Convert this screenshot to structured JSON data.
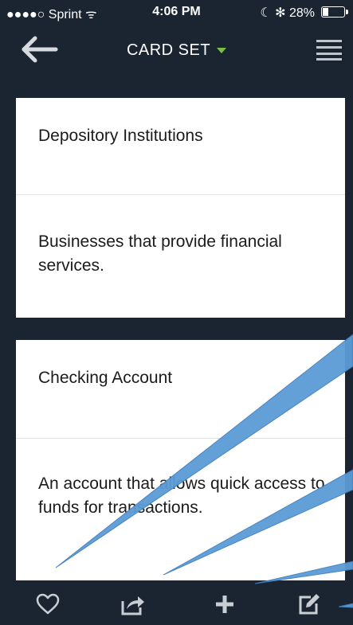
{
  "status_bar": {
    "carrier": "●●●●○ Sprint ᯤ",
    "time": "4:06 PM",
    "battery": "☾ ✻ 28%",
    "battery_level": 0.28
  },
  "navbar": {
    "title": "CARD SET",
    "back_icon": "arrow-left-icon",
    "menu_icon": "hamburger-menu-icon",
    "caret_color": "#7bc043"
  },
  "cards": [
    {
      "term": "Depository Institutions",
      "definition": "Businesses that provide financial services."
    },
    {
      "term": "Checking Account",
      "definition": "An account that allows quick access to funds for transactions."
    }
  ],
  "toolbar": {
    "items": [
      "heart-icon",
      "share-icon",
      "plus-icon",
      "edit-icon"
    ]
  },
  "colors": {
    "background": "#1b2532",
    "card": "#ffffff",
    "callout": "#5b9bd5"
  }
}
